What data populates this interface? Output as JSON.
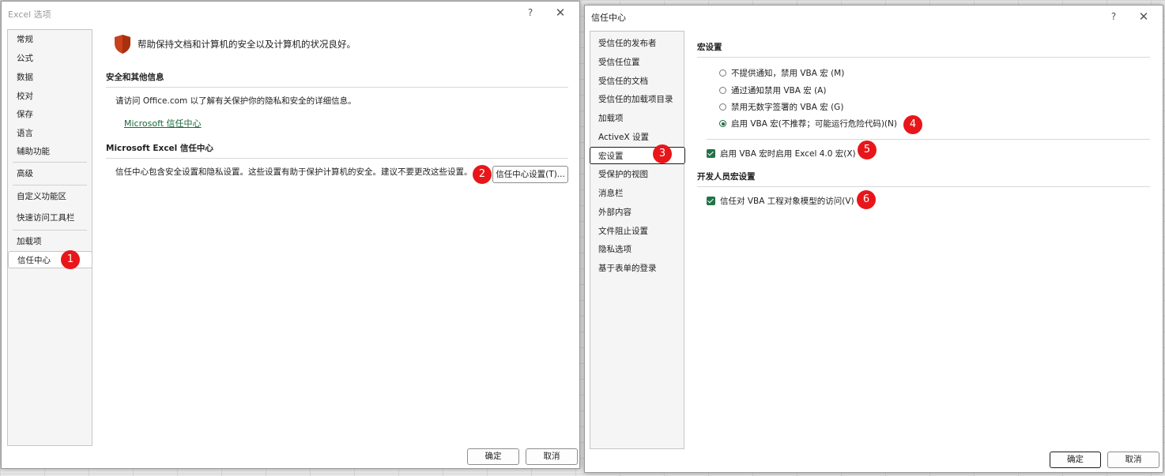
{
  "dialog1": {
    "title": "Excel 选项",
    "help": "?",
    "close": "✕",
    "nav": [
      "常规",
      "公式",
      "数据",
      "校对",
      "保存",
      "语言",
      "辅助功能",
      "高级",
      "自定义功能区",
      "快速访问工具栏",
      "加载项",
      "信任中心"
    ],
    "header": "帮助保持文档和计算机的安全以及计算机的状况良好。",
    "section1_title": "安全和其他信息",
    "section1_text": "请访问 Office.com 以了解有关保护你的隐私和安全的详细信息。",
    "section1_link": "Microsoft 信任中心",
    "section2_title": "Microsoft Excel 信任中心",
    "section2_text": "信任中心包含安全设置和隐私设置。这些设置有助于保护计算机的安全。建议不要更改这些设置。",
    "trust_button": "信任中心设置(T)...",
    "ok": "确定",
    "cancel": "取消"
  },
  "dialog2": {
    "title": "信任中心",
    "help": "?",
    "close": "✕",
    "nav": [
      "受信任的发布者",
      "受信任位置",
      "受信任的文档",
      "受信任的加载项目录",
      "加载项",
      "ActiveX 设置",
      "宏设置",
      "受保护的视图",
      "消息栏",
      "外部内容",
      "文件阻止设置",
      "隐私选项",
      "基于表单的登录"
    ],
    "macro_title": "宏设置",
    "radios": [
      "不提供通知，禁用 VBA 宏 (M)",
      "通过通知禁用 VBA 宏 (A)",
      "禁用无数字签署的 VBA 宏 (G)",
      "启用 VBA 宏(不推荐；可能运行危险代码)(N)"
    ],
    "excel4_check": "启用 VBA 宏时启用 Excel 4.0 宏(X)",
    "dev_title": "开发人员宏设置",
    "vba_check": "信任对 VBA 工程对象模型的访问(V)",
    "ok": "确定",
    "cancel": "取消"
  },
  "badges": [
    "1",
    "2",
    "3",
    "4",
    "5",
    "6"
  ],
  "colors": {
    "badge": "#e8161a",
    "check": "#217346",
    "link": "#1b6a3a",
    "shield": "#c8401c"
  }
}
